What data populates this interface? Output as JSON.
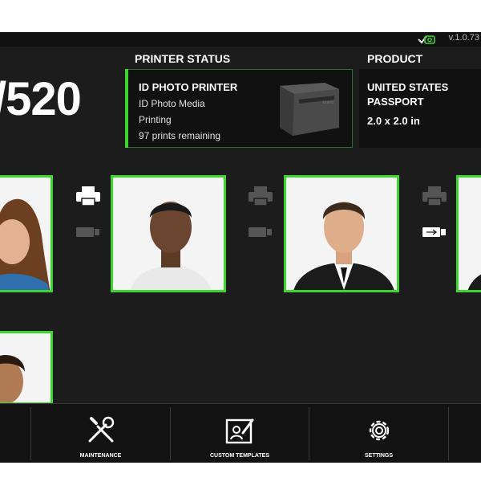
{
  "header": {
    "version": "v.1.0.73",
    "model": "/520"
  },
  "printer_status": {
    "title": "PRINTER STATUS",
    "name": "ID PHOTO PRINTER",
    "media": "ID Photo Media",
    "state": "Printing",
    "remaining": "97 prints remaining"
  },
  "product": {
    "title": "PRODUCT",
    "line1": "UNITED STATES",
    "line2": "PASSPORT",
    "size": "2.0 x 2.0 in"
  },
  "photos": [
    {
      "name": "photo-woman-left"
    },
    {
      "name": "photo-man-1"
    },
    {
      "name": "photo-man-2"
    },
    {
      "name": "photo-right-partial"
    },
    {
      "name": "photo-boy"
    }
  ],
  "nav": {
    "items": [
      {
        "label": "MAINTENANCE",
        "icon": "wrench-screwdriver-icon"
      },
      {
        "label": "CUSTOM TEMPLATES",
        "icon": "template-edit-icon"
      },
      {
        "label": "SETTINGS",
        "icon": "gear-icon"
      }
    ]
  },
  "colors": {
    "accent": "#3ed62e",
    "background": "#1c1c1c",
    "card": "#111111"
  }
}
